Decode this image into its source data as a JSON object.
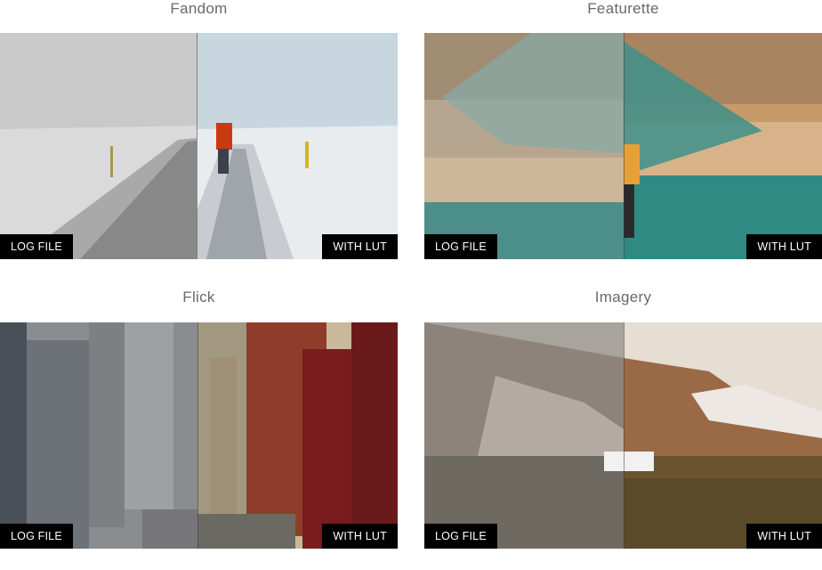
{
  "cards": [
    {
      "title": "Fandom",
      "left_tag": "LOG FILE",
      "right_tag": "WITH LUT"
    },
    {
      "title": "Featurette",
      "left_tag": "LOG FILE",
      "right_tag": "WITH LUT"
    },
    {
      "title": "Flick",
      "left_tag": "LOG FILE",
      "right_tag": "WITH LUT"
    },
    {
      "title": "Imagery",
      "left_tag": "LOG FILE",
      "right_tag": "WITH LUT"
    }
  ]
}
